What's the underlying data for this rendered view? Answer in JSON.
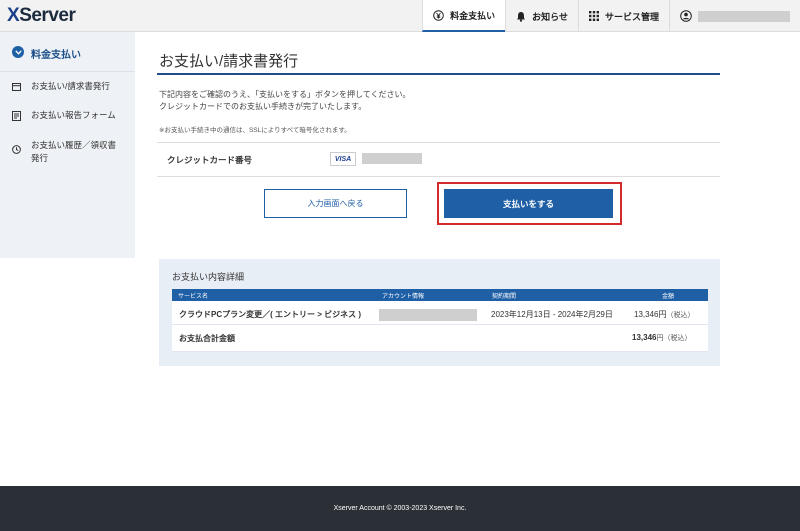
{
  "header": {
    "logo": "XServer",
    "nav": [
      {
        "label": "料金支払い",
        "icon": "yen-icon"
      },
      {
        "label": "お知らせ",
        "icon": "bell-icon"
      },
      {
        "label": "サービス管理",
        "icon": "grid-icon"
      }
    ]
  },
  "sidebar": {
    "heading": "料金支払い",
    "items": [
      {
        "label": "お支払い/請求書発行",
        "icon": "card-icon"
      },
      {
        "label": "お支払い報告フォーム",
        "icon": "form-icon"
      },
      {
        "label": "お支払い履歴／領収書発行",
        "icon": "clock-icon"
      }
    ]
  },
  "main": {
    "title": "お支払い/請求書発行",
    "desc_line1": "下記内容をご確認のうえ、「支払いをする」ボタンを押してください。",
    "desc_line2": "クレジットカードでのお支払い手続きが完了いたします。",
    "note": "※お支払い手続き中の通信は、SSLによりすべて暗号化されます。",
    "cc_label": "クレジットカード番号",
    "cc_brand": "VISA",
    "back_button": "入力画面へ戻る",
    "pay_button": "支払いをする"
  },
  "details": {
    "title": "お支払い内容詳細",
    "headers": [
      "サービス名",
      "アカウント情報",
      "契約期間",
      "金額"
    ],
    "row": {
      "service": "クラウドPCプラン変更／( エントリー > ビジネス )",
      "period": "2023年12月13日 - 2024年2月29日",
      "amount": "13,346円",
      "tax": "（税込）"
    },
    "total": {
      "label": "お支払合計金額",
      "amount": "13,346",
      "unit": "円",
      "tax": "（税込）"
    }
  },
  "footer": {
    "text": "Xserver Account © 2003-2023 Xserver Inc."
  }
}
